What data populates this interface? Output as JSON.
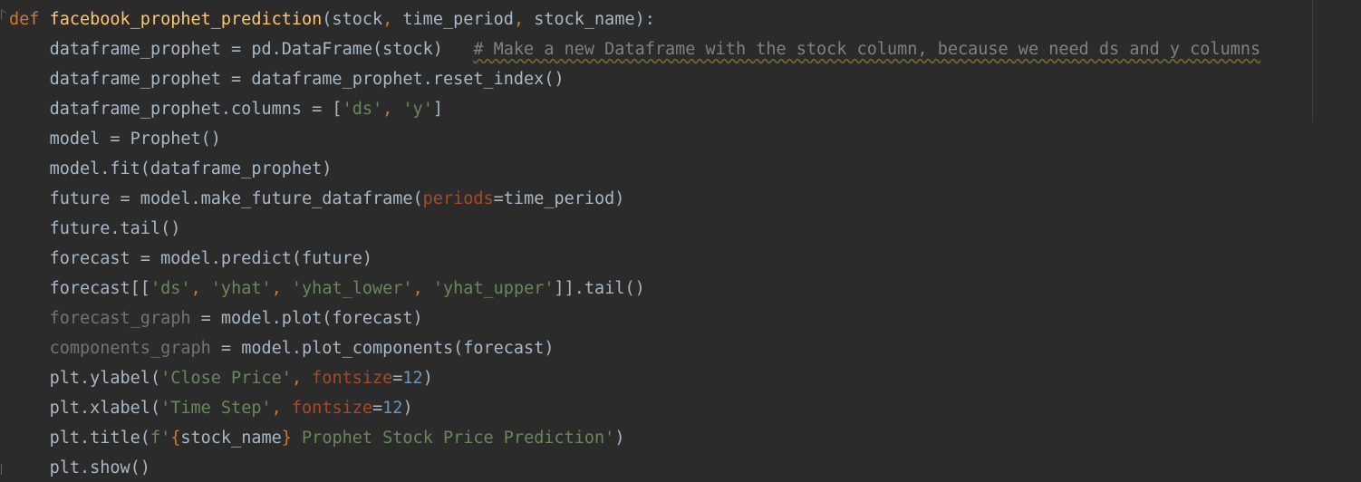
{
  "editor": {
    "lines": [
      {
        "indent": "",
        "tokens": [
          {
            "t": "def",
            "c": "kw"
          },
          {
            "t": " ",
            "c": "plain"
          },
          {
            "t": "facebook_prophet_prediction",
            "c": "fn"
          },
          {
            "t": "(stock",
            "c": "plain"
          },
          {
            "t": ", ",
            "c": "kw"
          },
          {
            "t": "time_period",
            "c": "plain"
          },
          {
            "t": ", ",
            "c": "kw"
          },
          {
            "t": "stock_name):",
            "c": "plain"
          }
        ]
      },
      {
        "indent": "    ",
        "tokens": [
          {
            "t": "dataframe_prophet = pd.DataFrame(stock)   ",
            "c": "plain"
          },
          {
            "t": "# Make a new Dataframe with the stock column, because we need ds and y columns",
            "c": "cm"
          }
        ]
      },
      {
        "indent": "    ",
        "tokens": [
          {
            "t": "dataframe_prophet = dataframe_prophet.reset_index()",
            "c": "plain"
          }
        ]
      },
      {
        "indent": "    ",
        "tokens": [
          {
            "t": "dataframe_prophet.columns = [",
            "c": "plain"
          },
          {
            "t": "'ds'",
            "c": "str"
          },
          {
            "t": ", ",
            "c": "kw"
          },
          {
            "t": "'y'",
            "c": "str"
          },
          {
            "t": "]",
            "c": "plain"
          }
        ]
      },
      {
        "indent": "    ",
        "tokens": [
          {
            "t": "model = Prophet()",
            "c": "plain"
          }
        ]
      },
      {
        "indent": "    ",
        "tokens": [
          {
            "t": "model.fit(dataframe_prophet)",
            "c": "plain"
          }
        ]
      },
      {
        "indent": "    ",
        "tokens": [
          {
            "t": "future = model.make_future_dataframe(",
            "c": "plain"
          },
          {
            "t": "periods",
            "c": "param"
          },
          {
            "t": "=time_period)",
            "c": "plain"
          }
        ]
      },
      {
        "indent": "    ",
        "tokens": [
          {
            "t": "future.tail()",
            "c": "plain"
          }
        ]
      },
      {
        "indent": "    ",
        "tokens": [
          {
            "t": "forecast = model.predict(future)",
            "c": "plain"
          }
        ]
      },
      {
        "indent": "    ",
        "tokens": [
          {
            "t": "forecast[[",
            "c": "plain"
          },
          {
            "t": "'ds'",
            "c": "str"
          },
          {
            "t": ", ",
            "c": "kw"
          },
          {
            "t": "'yhat'",
            "c": "str"
          },
          {
            "t": ", ",
            "c": "kw"
          },
          {
            "t": "'yhat_lower'",
            "c": "str"
          },
          {
            "t": ", ",
            "c": "kw"
          },
          {
            "t": "'yhat_upper'",
            "c": "str"
          },
          {
            "t": "]].tail()",
            "c": "plain"
          }
        ]
      },
      {
        "indent": "    ",
        "tokens": [
          {
            "t": "forecast_graph",
            "c": "unused"
          },
          {
            "t": " = model.plot(forecast)",
            "c": "plain"
          }
        ]
      },
      {
        "indent": "    ",
        "tokens": [
          {
            "t": "components_graph",
            "c": "unused"
          },
          {
            "t": " = model.plot_components(forecast)",
            "c": "plain"
          }
        ]
      },
      {
        "indent": "    ",
        "tokens": [
          {
            "t": "plt.ylabel(",
            "c": "plain"
          },
          {
            "t": "'Close Price'",
            "c": "str"
          },
          {
            "t": ", ",
            "c": "kw"
          },
          {
            "t": "fontsize",
            "c": "param"
          },
          {
            "t": "=",
            "c": "plain"
          },
          {
            "t": "12",
            "c": "num"
          },
          {
            "t": ")",
            "c": "plain"
          }
        ]
      },
      {
        "indent": "    ",
        "tokens": [
          {
            "t": "plt.xlabel(",
            "c": "plain"
          },
          {
            "t": "'Time Step'",
            "c": "str"
          },
          {
            "t": ", ",
            "c": "kw"
          },
          {
            "t": "fontsize",
            "c": "param"
          },
          {
            "t": "=",
            "c": "plain"
          },
          {
            "t": "12",
            "c": "num"
          },
          {
            "t": ")",
            "c": "plain"
          }
        ]
      },
      {
        "indent": "    ",
        "tokens": [
          {
            "t": "plt.title(",
            "c": "plain"
          },
          {
            "t": "f'",
            "c": "str"
          },
          {
            "t": "{",
            "c": "kw"
          },
          {
            "t": "stock_name",
            "c": "plain"
          },
          {
            "t": "}",
            "c": "kw"
          },
          {
            "t": " Prophet Stock Price Prediction'",
            "c": "str"
          },
          {
            "t": ")",
            "c": "plain"
          }
        ]
      },
      {
        "indent": "    ",
        "tokens": [
          {
            "t": "plt.show()",
            "c": "plain"
          }
        ]
      }
    ]
  },
  "colors": {
    "background": "#2b2b2b",
    "keyword": "#cc7832",
    "function_name": "#ffc66d",
    "string": "#6a8759",
    "number": "#6897bb",
    "named_param": "#aa4926",
    "comment": "#808080",
    "unused_variable": "#72737a",
    "default_text": "#a9b7c6"
  }
}
